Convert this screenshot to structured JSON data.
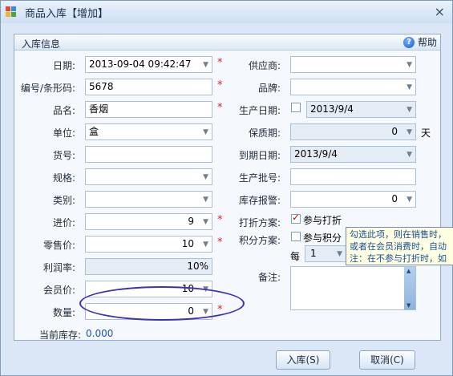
{
  "window": {
    "title": "商品入库【增加】",
    "close": "×"
  },
  "group": {
    "title": "入库信息",
    "help": "帮助"
  },
  "left": {
    "date": {
      "label": "日期:",
      "value": "2013-09-04 09:42:47"
    },
    "barcode": {
      "label": "编号/条形码:",
      "value": "5678"
    },
    "name": {
      "label": "品名:",
      "value": "香烟"
    },
    "unit": {
      "label": "单位:",
      "value": "盒"
    },
    "goods_no": {
      "label": "货号:",
      "value": ""
    },
    "spec": {
      "label": "规格:",
      "value": ""
    },
    "category": {
      "label": "类别:",
      "value": ""
    },
    "purchase_price": {
      "label": "进价:",
      "value": "9"
    },
    "retail_price": {
      "label": "零售价:",
      "value": "10"
    },
    "profit_rate": {
      "label": "利润率:",
      "value": "10%"
    },
    "member_price": {
      "label": "会员价:",
      "value": "10"
    },
    "quantity": {
      "label": "数量:",
      "value": "0"
    },
    "stock": {
      "label": "当前库存:",
      "value": "0.000"
    }
  },
  "right": {
    "supplier": {
      "label": "供应商:",
      "value": ""
    },
    "brand": {
      "label": "品牌:",
      "value": ""
    },
    "prod_date": {
      "label": "生产日期:",
      "value": "2013/9/4"
    },
    "shelf_life": {
      "label": "保质期:",
      "value": "0",
      "unit": "天"
    },
    "expire": {
      "label": "到期日期:",
      "value": "2013/9/4"
    },
    "batch": {
      "label": "生产批号:",
      "value": ""
    },
    "stock_alert": {
      "label": "库存报警:",
      "value": "0"
    },
    "discount": {
      "label": "打折方案:",
      "option": "参与打折"
    },
    "points": {
      "label": "积分方案:",
      "option": "参与积分",
      "every": "每",
      "every_value": "1"
    },
    "remark": {
      "label": "备注:"
    }
  },
  "tooltip": {
    "line1": "勾选此项，则在销售时，",
    "line2": "或者在会员消费时，自动",
    "line3": "注：在不参与打折时，如"
  },
  "buttons": {
    "ok": "入库(S)",
    "cancel": "取消(C)"
  },
  "colors": {
    "required": "#e0201b",
    "stock_value": "#1e50c8",
    "annotation": "#3b2fbf"
  }
}
